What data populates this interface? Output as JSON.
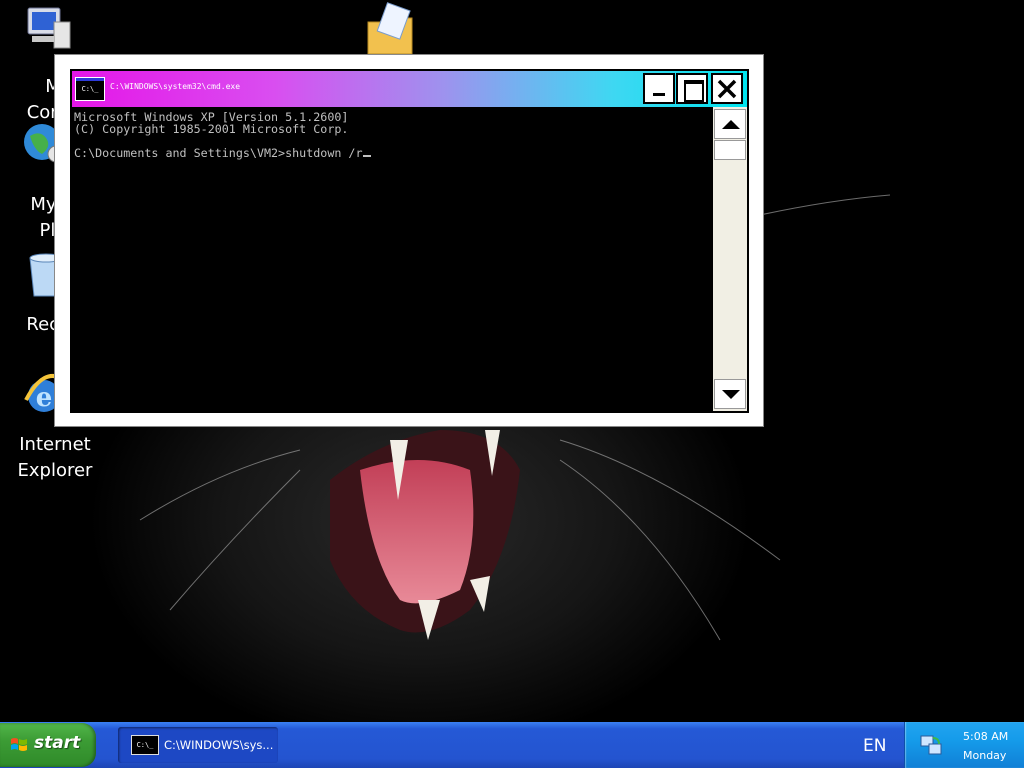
{
  "desktop": {
    "icons": [
      {
        "name": "My Computer",
        "icon": "my-computer-icon",
        "label_visible": "M\nComp"
      },
      {
        "name": "My Network Places",
        "icon": "network-places-icon",
        "label_visible": "My N\nPla"
      },
      {
        "name": "Recycle Bin",
        "icon": "recycle-bin-icon",
        "label_visible": "Recyc"
      },
      {
        "name": "Internet Explorer",
        "icon": "internet-explorer-icon",
        "label_visible": "Internet\nExplorer"
      },
      {
        "name": "My Documents",
        "icon": "my-documents-icon",
        "label_visible": ""
      }
    ]
  },
  "cmd_window": {
    "title": "C:\\WINDOWS\\system32\\cmd.exe",
    "icon_text": "C:\\_",
    "console_lines": [
      "Microsoft Windows XP [Version 5.1.2600]",
      "(C) Copyright 1985-2001 Microsoft Corp.",
      "",
      "C:\\Documents and Settings\\VM2>shutdown /r"
    ]
  },
  "taskbar": {
    "start_label": "start",
    "tasks": [
      {
        "label": "C:\\WINDOWS\\sys...",
        "icon_text": "C:\\_",
        "active": true
      }
    ],
    "language": "EN",
    "clock_time": "5:08 AM",
    "clock_day": "Monday"
  },
  "colors": {
    "title_gradient_start": "#e516e8",
    "title_gradient_end": "#00e4ee",
    "taskbar_blue": "#2454d0",
    "start_green": "#3c9c35",
    "tray_blue": "#159bea"
  }
}
